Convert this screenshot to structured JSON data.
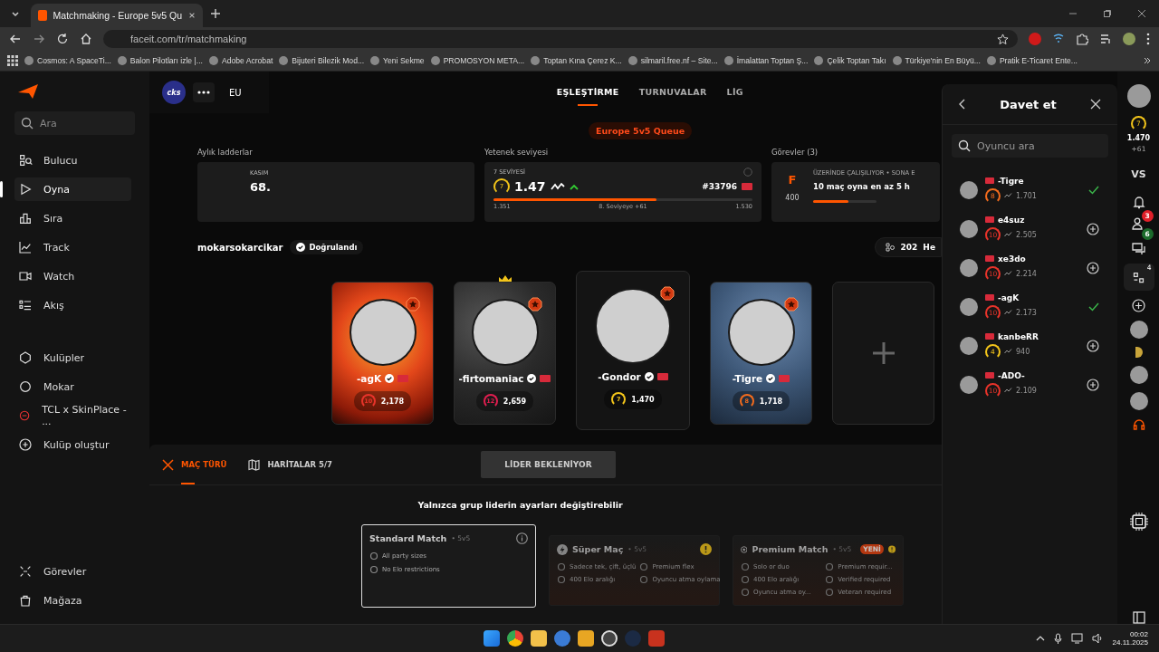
{
  "browser": {
    "tab_title": "Matchmaking - Europe 5v5 Qu",
    "url": "faceit.com/tr/matchmaking",
    "bookmarks": [
      "Cosmos: A SpaceTi...",
      "Balon Pilotları izle |...",
      "Adobe Acrobat",
      "Bijuteri Bilezik Mod...",
      "Yeni Sekme",
      "PROMOSYON META...",
      "Toptan Kına Çerez K...",
      "silmaril.free.nf – Site...",
      "İmalattan Toptan Ş...",
      "Çelik Toptan Takı",
      "Türkiye'nin En Büyü...",
      "Pratik E-Ticaret Ente..."
    ]
  },
  "sidebar": {
    "search_placeholder": "Ara",
    "nav": [
      {
        "label": "Bulucu",
        "selected": false
      },
      {
        "label": "Oyna",
        "selected": true
      },
      {
        "label": "Sıra",
        "selected": false
      },
      {
        "label": "Track",
        "selected": false
      },
      {
        "label": "Watch",
        "selected": false
      },
      {
        "label": "Akış",
        "selected": false
      }
    ],
    "clubs": [
      "Kulüpler",
      "Mokar",
      "TCL x SkinPlace - ...",
      "Kulüp oluştur"
    ],
    "bottom": [
      "Görevler",
      "Mağaza"
    ]
  },
  "party": {
    "badge": "cks",
    "region": "EU"
  },
  "tabs": [
    {
      "label": "EŞLEŞTİRME",
      "selected": true
    },
    {
      "label": "TURNUVALAR",
      "selected": false
    },
    {
      "label": "LİG",
      "selected": false
    }
  ],
  "queue": "Europe 5v5 Queue",
  "ladder": {
    "title": "Aylık ladderlar",
    "month": "KASIM",
    "rank": "68."
  },
  "skill": {
    "title": "Yetenek seviyesi",
    "caption": "7 SEVİYESİ",
    "badge": "7",
    "value": "1.47",
    "rank": "#33796",
    "level": 0.63,
    "min": "1.351",
    "next": "8. Seviyeye +61",
    "max": "1.530"
  },
  "missions": {
    "title": "Görevler (3)",
    "grade": "F",
    "points": "400",
    "status": "ÜZERİNDE ÇALIŞILIYOR • SONA E",
    "task": "10 maç oyna en az 5 h",
    "level": 0.55
  },
  "user": {
    "name": "mokarsokarcikar",
    "verified": "Doğrulandı",
    "count": "202",
    "count_label": "He"
  },
  "players": [
    {
      "name": "-agK",
      "skill": "10",
      "elo": "2,178",
      "color": "#e8332a",
      "leader": false,
      "current": false,
      "kind": "fire"
    },
    {
      "name": "-firtomaniac",
      "skill": "12",
      "elo": "2,659",
      "color": "#e01e4f",
      "leader": true,
      "current": false,
      "kind": "smoke"
    },
    {
      "name": "-Gondor",
      "skill": "7",
      "elo": "1,470",
      "color": "#f2c41a",
      "leader": false,
      "current": true,
      "kind": "plain"
    },
    {
      "name": "-Tigre",
      "skill": "8",
      "elo": "1,718",
      "color": "#f26b1d",
      "leader": false,
      "current": false,
      "kind": "clouds"
    }
  ],
  "match_tabs": [
    {
      "label": "MAÇ TÜRÜ",
      "selected": true
    },
    {
      "label": "HARİTALAR 5/7",
      "selected": false
    }
  ],
  "waiting_button": "LİDER BEKLENİYOR",
  "notice": "Yalnızca grup liderin ayarları değiştirebilir",
  "match_types": [
    {
      "name": "Standard Match",
      "mode": "• 5v5",
      "selected": true,
      "warning": false,
      "features": [
        "All party sizes",
        "No Elo restrictions"
      ]
    },
    {
      "name": "Süper Maç",
      "mode": "• 5v5",
      "selected": false,
      "warning": true,
      "features": [
        "Sadece tek, çift, üçlü",
        "Premium flex",
        "400 Elo aralığı",
        "Oyuncu atma oylama"
      ]
    },
    {
      "name": "Premium Match",
      "mode": "• 5v5",
      "badge": "YENİ",
      "selected": false,
      "warning": true,
      "features": [
        "Solo or duo",
        "Premium requir...",
        "400 Elo aralığı",
        "Verified required",
        "Oyuncu atma oy...",
        "Veteran required"
      ]
    }
  ],
  "invite": {
    "title": "Davet et",
    "search_placeholder": "Oyuncu ara",
    "friends": [
      {
        "name": "-Tigre",
        "skill": "8",
        "elo": "1.701",
        "color": "#f26b1d",
        "invited": true
      },
      {
        "name": "e4suz",
        "skill": "10",
        "elo": "2.505",
        "color": "#e8332a",
        "invited": false
      },
      {
        "name": "xe3do",
        "skill": "10",
        "elo": "2.214",
        "color": "#e8332a",
        "invited": false
      },
      {
        "name": "-agK",
        "skill": "10",
        "elo": "2.173",
        "color": "#e8332a",
        "invited": true
      },
      {
        "name": "kanbeRR",
        "skill": "4",
        "elo": "940",
        "color": "#f2c41a",
        "invited": false
      },
      {
        "name": "-ADO-",
        "skill": "10",
        "elo": "2.109",
        "color": "#e8332a",
        "invited": false
      }
    ]
  },
  "rail": {
    "skill": "7",
    "elo": "1.470",
    "gain": "+61",
    "vs": "VS",
    "requests": "3",
    "online": "6",
    "party_size": "4"
  },
  "taskbar": {
    "time": "00:02",
    "date": "24.11.2025"
  }
}
